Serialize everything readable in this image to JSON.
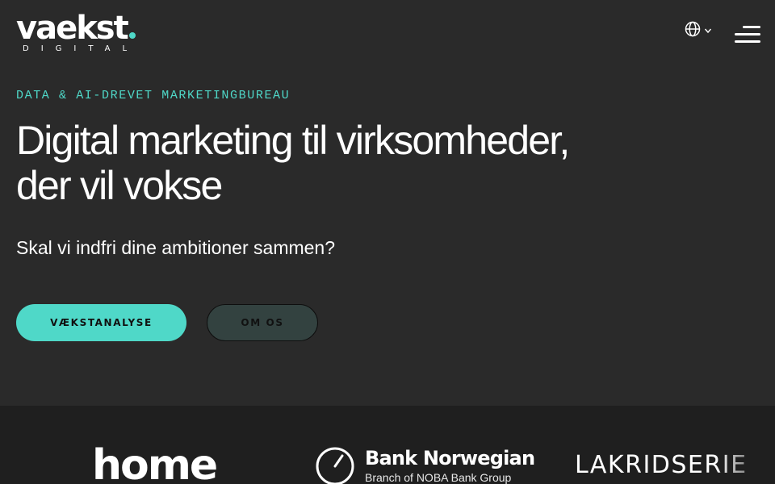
{
  "header": {
    "logo_word": "vaekst",
    "logo_sub": "DIGITAL",
    "language_icon": "globe-icon",
    "language_chevron": "chevron-down-icon",
    "menu_icon": "hamburger-menu-icon"
  },
  "hero": {
    "eyebrow": "DATA & AI-DREVET MARKETINGBUREAU",
    "headline_line1": "Digital marketing til virksomheder,",
    "headline_line2": "der vil vokse",
    "subline": "Skal vi indfri dine ambitioner sammen?",
    "primary_button": "VÆKSTANALYSE",
    "secondary_button": "OM OS"
  },
  "client_logos": {
    "home": "home",
    "bank_name": "Bank Norwegian",
    "bank_sub": "Branch of NOBA Bank Group",
    "lakrids": "LAKRIDSERIE"
  },
  "colors": {
    "accent": "#4fd8c8",
    "background": "#2a2a2a",
    "logo_strip": "#1f1f1f"
  }
}
